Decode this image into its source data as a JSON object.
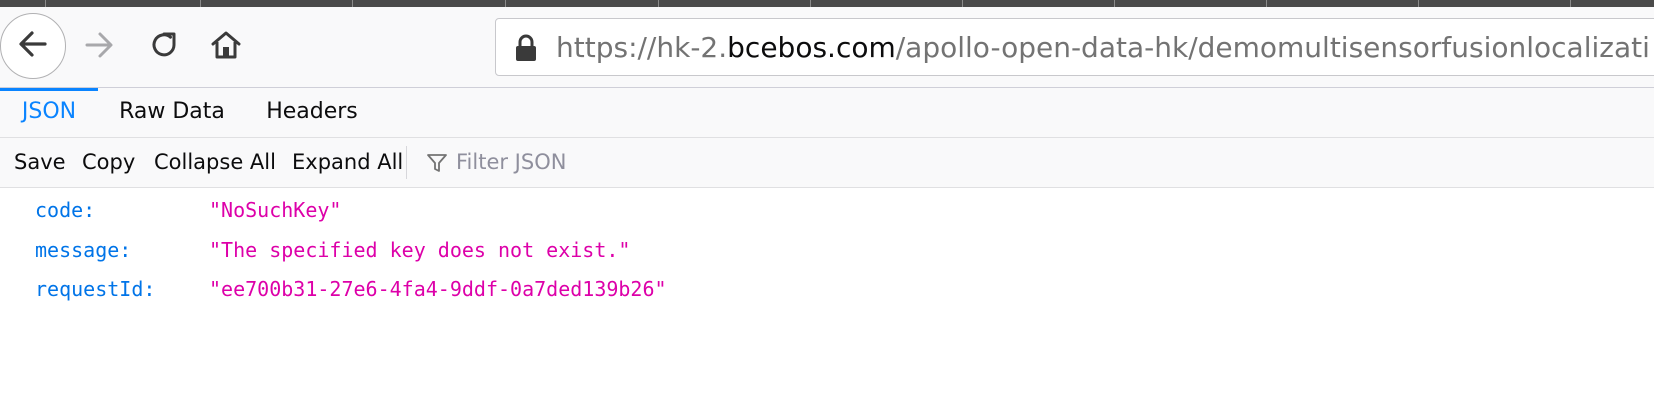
{
  "browser": {
    "url": {
      "prefix": "https://hk-2.",
      "domain": "bcebos.com",
      "path": "/apollo-open-data-hk/demomultisensorfusionlocalizati"
    },
    "icons": {
      "back": "back-arrow-icon",
      "forward": "forward-arrow-icon",
      "reload": "reload-icon",
      "home": "home-icon",
      "lock": "lock-icon"
    }
  },
  "viewer": {
    "tabs": [
      {
        "label": "JSON",
        "active": true
      },
      {
        "label": "Raw Data",
        "active": false
      },
      {
        "label": "Headers",
        "active": false
      }
    ],
    "toolbar": {
      "save": "Save",
      "copy": "Copy",
      "collapse_all": "Collapse All",
      "expand_all": "Expand All",
      "filter_placeholder": "Filter JSON"
    }
  },
  "json": {
    "rows": [
      {
        "key": "code:",
        "value": "\"NoSuchKey\""
      },
      {
        "key": "message:",
        "value": "\"The specified key does not exist.\""
      },
      {
        "key": "requestId:",
        "value": "\"ee700b31-27e6-4fa4-9ddf-0a7ded139b26\""
      }
    ]
  },
  "colors": {
    "accent": "#0a84ff",
    "json_key": "#0074e8",
    "json_string": "#dd00a9"
  }
}
